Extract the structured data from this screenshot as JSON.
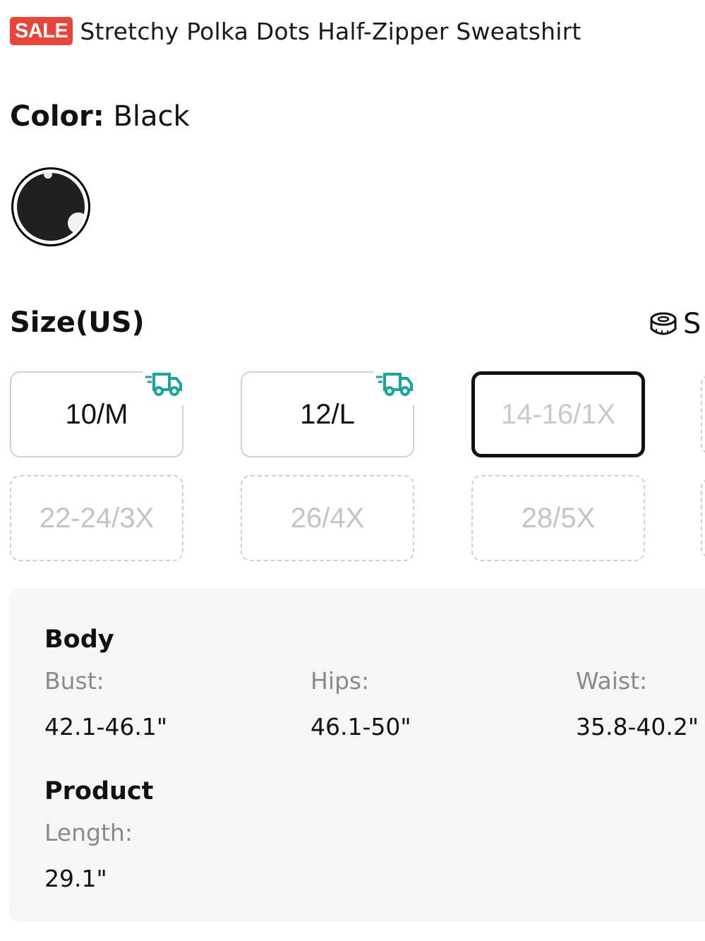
{
  "header": {
    "sale_badge": "SALE",
    "title": "Stretchy Polka Dots Half-Zipper Sweatshirt"
  },
  "color": {
    "label": "Color:",
    "value": "Black",
    "swatch_color": "#202020"
  },
  "size": {
    "label": "Size(US)",
    "guide_label": "S",
    "options": [
      {
        "label": "10/M",
        "state": "available",
        "fast_shipping": true
      },
      {
        "label": "12/L",
        "state": "available",
        "fast_shipping": true
      },
      {
        "label": "14-16/1X",
        "state": "selected-soldout",
        "fast_shipping": false
      },
      {
        "label": "22-24/3X",
        "state": "soldout",
        "fast_shipping": false
      },
      {
        "label": "26/4X",
        "state": "soldout",
        "fast_shipping": false
      },
      {
        "label": "28/5X",
        "state": "soldout",
        "fast_shipping": false
      }
    ]
  },
  "measurements": {
    "body_heading": "Body",
    "body": [
      {
        "label": "Bust:",
        "value": "42.1-46.1\""
      },
      {
        "label": "Hips:",
        "value": "46.1-50\""
      },
      {
        "label": "Waist:",
        "value": "35.8-40.2\""
      }
    ],
    "product_heading": "Product",
    "product": [
      {
        "label": "Length:",
        "value": "29.1\""
      }
    ]
  },
  "colors": {
    "sale": "#e8443a",
    "shipping_icon": "#1aa59a"
  }
}
